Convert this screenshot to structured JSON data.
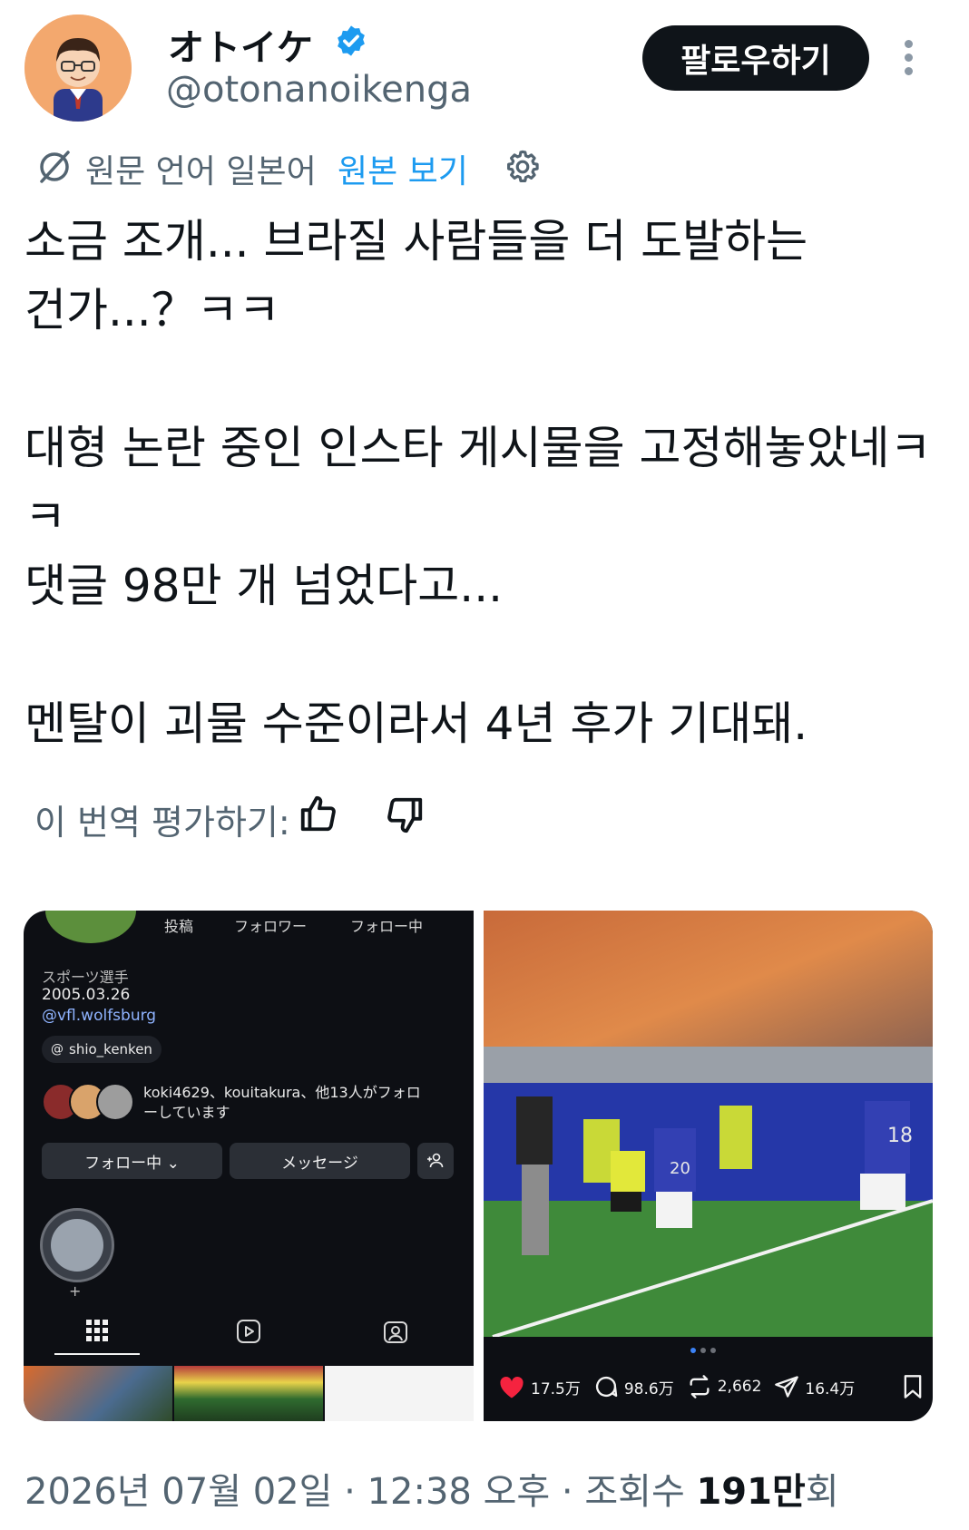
{
  "author": {
    "display_name": "オトイケ",
    "handle": "@otonanoikenga",
    "follow_label": "팔로우하기"
  },
  "translation": {
    "note": "원문 언어 일본어",
    "view_original": "원본 보기",
    "rate_label": "이 번역 평가하기:"
  },
  "tweet": {
    "text": "소금 조개... 브라질 사람들을 더 도발하는\n건가...？ㅋㅋ\n\n대형 논란 중인 인스타 게시물을 고정해놓았네ㅋ\nㅋ\n댓글 98만 개 넘었다고...\n\n멘탈이 괴물 수준이라서 4년 후가 기대돼."
  },
  "instagram_profile": {
    "stats_labels": [
      "投稿",
      "フォロワー",
      "フォロー中"
    ],
    "category": "スポーツ選手",
    "birthdate": "2005.03.26",
    "link": "@vfl.wolfsburg",
    "threads_handle": "shio_kenken",
    "followed_by_line1": "koki4629、kouitakura、他13人がフォロ",
    "followed_by_line2": "ーしています",
    "following_button": "フォロー中 ⌄",
    "message_button": "メッセージ",
    "add_person_icon": "add-person-icon",
    "highlight_plus": "+"
  },
  "instagram_post": {
    "likes": "17.5万",
    "comments": "98.6万",
    "reposts": "2,662",
    "shares": "16.4万",
    "jersey_number_1": "20",
    "jersey_number_2": "18"
  },
  "footer": {
    "date": "2026년 07월 02일",
    "sep1": " · ",
    "time": "12:38 오후",
    "sep2": " · ",
    "views_label": "조회수 ",
    "views_value": "191만",
    "views_suffix": "회"
  },
  "colors": {
    "text": "#0f1419",
    "secondary": "#536471",
    "accent": "#1d9bf0",
    "like": "#f91880"
  }
}
